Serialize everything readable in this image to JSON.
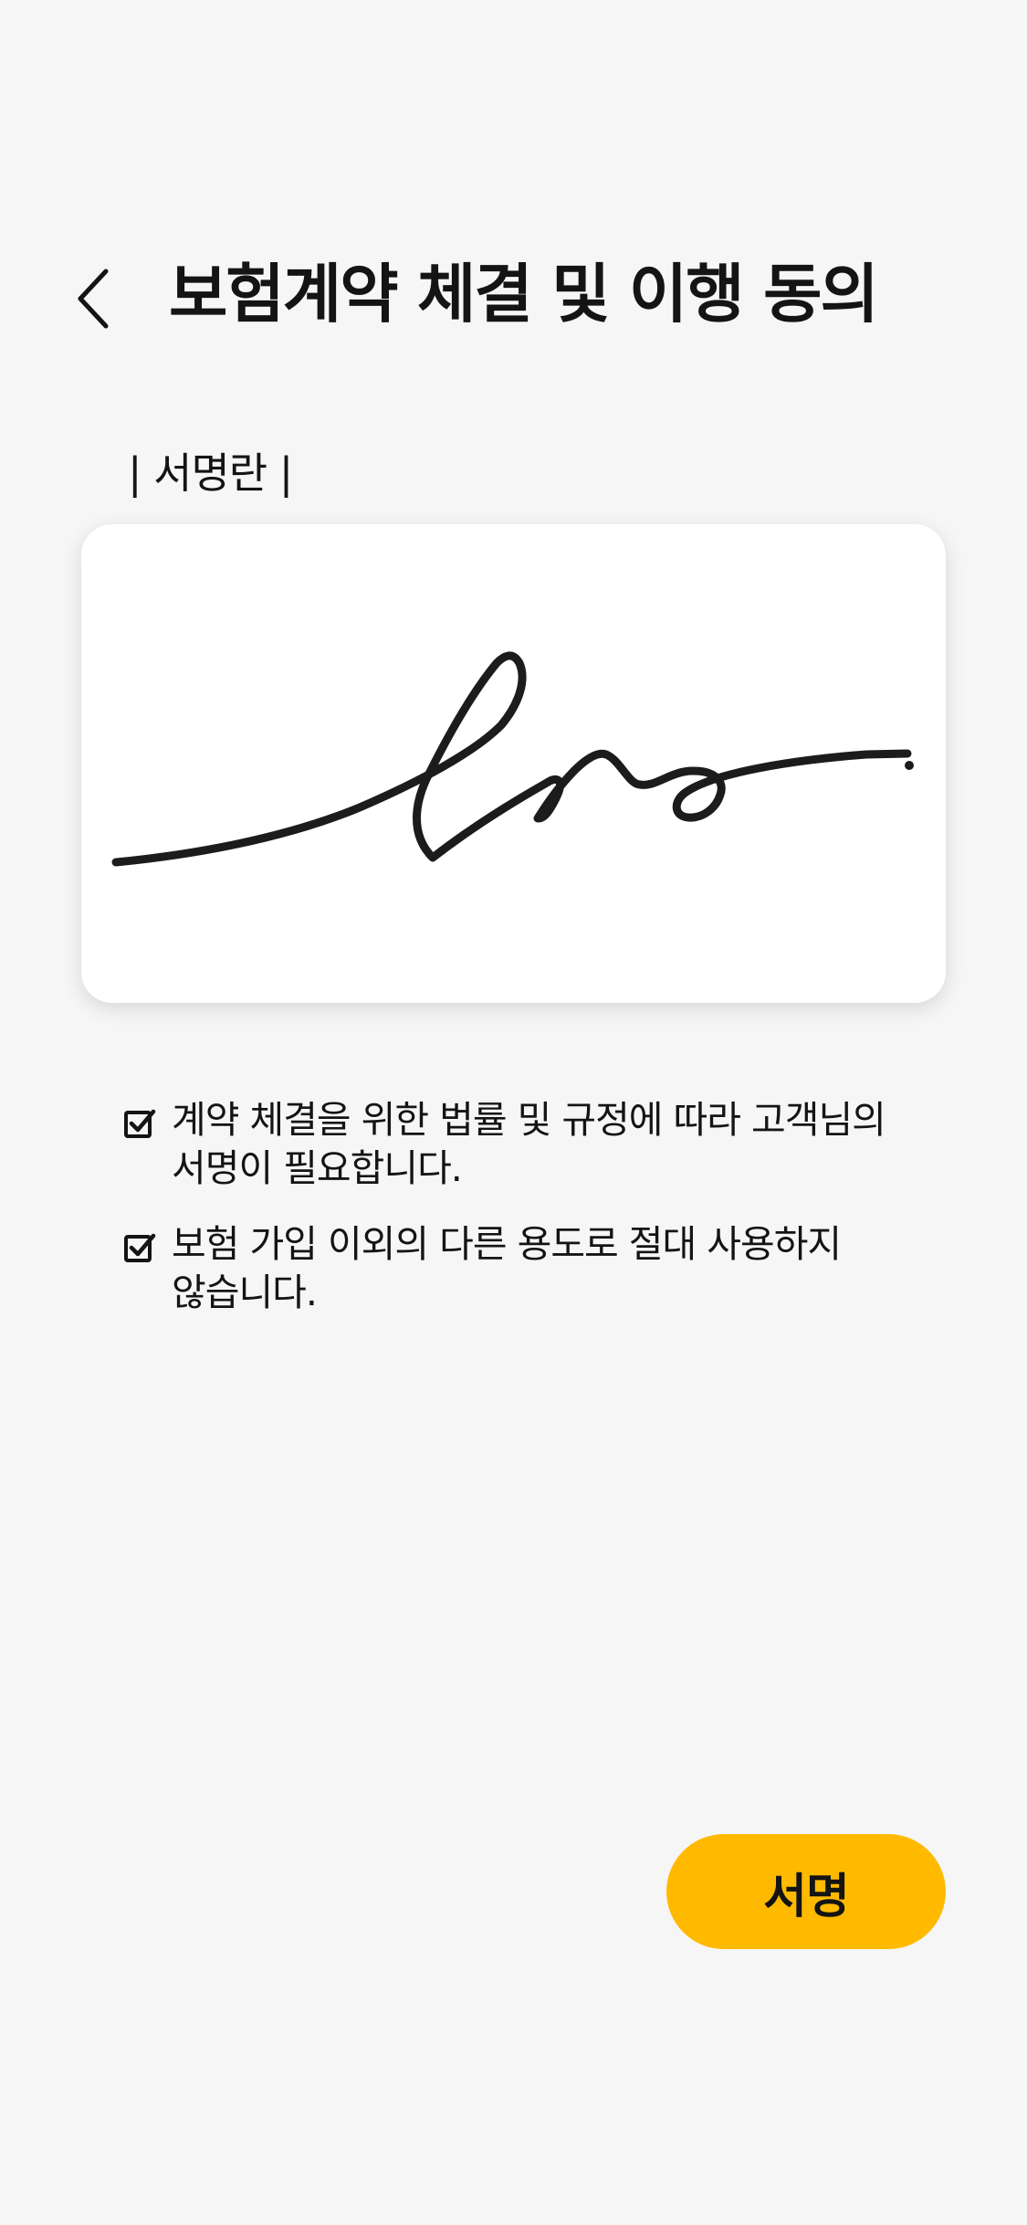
{
  "header": {
    "back_icon": "chevron-left-icon",
    "title": "보험계약 체결 및 이행 동의"
  },
  "signature": {
    "label": "| 서명란 |",
    "stroke_color": "#1c1c1c",
    "background_color": "#ffffff"
  },
  "notices": [
    {
      "icon": "checkbox-checked-icon",
      "text": "계약 체결을 위한 법률 및 규정에 따라 고객님의\n서명이 필요합니다."
    },
    {
      "icon": "checkbox-checked-icon",
      "text": "보험 가입 이외의 다른 용도로 절대 사용하지\n않습니다."
    }
  ],
  "actions": {
    "sign_label": "서명",
    "sign_color": "#ffba00"
  },
  "colors": {
    "background": "#f6f6f6",
    "text": "#141414",
    "accent": "#ffba00"
  }
}
